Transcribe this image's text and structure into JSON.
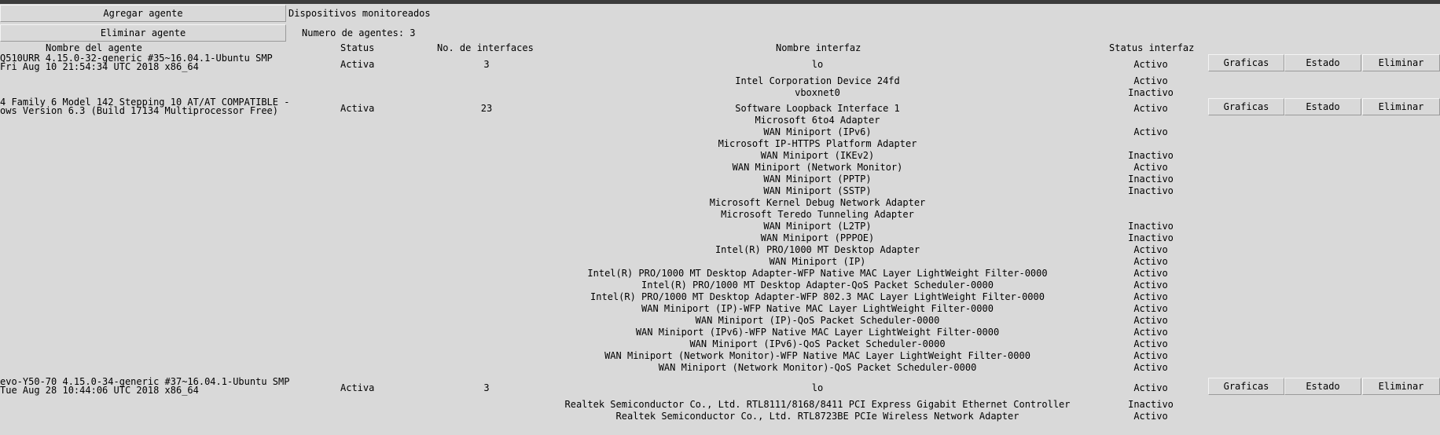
{
  "toolbar": {
    "add_label": "Agregar agente",
    "remove_label": "Eliminar agente",
    "monitored_label": "Dispositivos monitoreados",
    "agent_count_label": "Numero de agentes: 3"
  },
  "headers": {
    "agent_name": "Nombre del agente",
    "status": "Status",
    "interfaces": "No. de interfaces",
    "interface_name": "Nombre interfaz",
    "interface_status": "Status interfaz"
  },
  "actions": {
    "graphs": "Graficas",
    "state": "Estado",
    "delete": "Eliminar"
  },
  "agents": [
    {
      "name_lines": [
        "Q510URR 4.15.0-32-generic #35~16.04.1-Ubuntu SMP",
        "Fri Aug 10 21:54:34 UTC 2018 x86_64"
      ],
      "status": "Activa",
      "interface_count": "3",
      "interfaces": [
        {
          "name": "lo",
          "status": "Activo"
        },
        {
          "name": "Intel Corporation Device 24fd",
          "status": "Activo"
        },
        {
          "name": "vboxnet0",
          "status": "Inactivo"
        }
      ]
    },
    {
      "name_lines": [
        "4 Family 6 Model 142 Stepping 10 AT/AT COMPATIBLE -",
        "ows Version 6.3 (Build 17134 Multiprocessor Free)"
      ],
      "status": "Activa",
      "interface_count": "23",
      "interfaces": [
        {
          "name": "Software Loopback Interface 1",
          "status": "Activo"
        },
        {
          "name": "Microsoft 6to4 Adapter",
          "status": ""
        },
        {
          "name": "WAN Miniport (IPv6)",
          "status": "Activo"
        },
        {
          "name": "Microsoft IP-HTTPS Platform Adapter",
          "status": ""
        },
        {
          "name": "WAN Miniport (IKEv2)",
          "status": "Inactivo"
        },
        {
          "name": "WAN Miniport (Network Monitor)",
          "status": "Activo"
        },
        {
          "name": "WAN Miniport (PPTP)",
          "status": "Inactivo"
        },
        {
          "name": "WAN Miniport (SSTP)",
          "status": "Inactivo"
        },
        {
          "name": "Microsoft Kernel Debug Network Adapter",
          "status": ""
        },
        {
          "name": "Microsoft Teredo Tunneling Adapter",
          "status": ""
        },
        {
          "name": "WAN Miniport (L2TP)",
          "status": "Inactivo"
        },
        {
          "name": "WAN Miniport (PPPOE)",
          "status": "Inactivo"
        },
        {
          "name": "Intel(R) PRO/1000 MT Desktop Adapter",
          "status": "Activo"
        },
        {
          "name": "WAN Miniport (IP)",
          "status": "Activo"
        },
        {
          "name": "Intel(R) PRO/1000 MT Desktop Adapter-WFP Native MAC Layer LightWeight Filter-0000",
          "status": "Activo"
        },
        {
          "name": "Intel(R) PRO/1000 MT Desktop Adapter-QoS Packet Scheduler-0000",
          "status": "Activo"
        },
        {
          "name": "Intel(R) PRO/1000 MT Desktop Adapter-WFP 802.3 MAC Layer LightWeight Filter-0000",
          "status": "Activo"
        },
        {
          "name": "WAN Miniport (IP)-WFP Native MAC Layer LightWeight Filter-0000",
          "status": "Activo"
        },
        {
          "name": "WAN Miniport (IP)-QoS Packet Scheduler-0000",
          "status": "Activo"
        },
        {
          "name": "WAN Miniport (IPv6)-WFP Native MAC Layer LightWeight Filter-0000",
          "status": "Activo"
        },
        {
          "name": "WAN Miniport (IPv6)-QoS Packet Scheduler-0000",
          "status": "Activo"
        },
        {
          "name": "WAN Miniport (Network Monitor)-WFP Native MAC Layer LightWeight Filter-0000",
          "status": "Activo"
        },
        {
          "name": "WAN Miniport (Network Monitor)-QoS Packet Scheduler-0000",
          "status": "Activo"
        }
      ]
    },
    {
      "name_lines": [
        "evo-Y50-70 4.15.0-34-generic #37~16.04.1-Ubuntu SMP",
        "Tue Aug 28 10:44:06 UTC 2018 x86_64"
      ],
      "status": "Activa",
      "interface_count": "3",
      "interfaces": [
        {
          "name": "lo",
          "status": "Activo"
        },
        {
          "name": "Realtek Semiconductor Co., Ltd. RTL8111/8168/8411 PCI Express Gigabit Ethernet Controller",
          "status": "Inactivo"
        },
        {
          "name": "Realtek Semiconductor Co., Ltd. RTL8723BE PCIe Wireless Network Adapter",
          "status": "Activo"
        }
      ]
    }
  ]
}
